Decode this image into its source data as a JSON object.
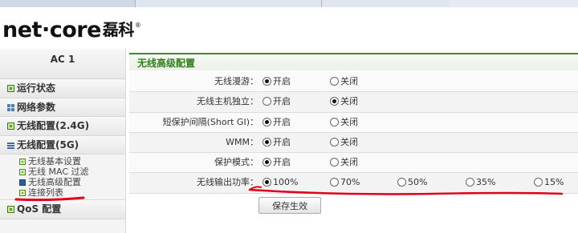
{
  "brand": {
    "logo_text": "net·core",
    "logo_cn": "磊科",
    "logo_mark": "®"
  },
  "sidebar": {
    "title": "AC 1",
    "items": [
      {
        "label": "运行状态",
        "icon": "green-square-icon"
      },
      {
        "label": "网络参数",
        "icon": "grid-icon"
      },
      {
        "label": "无线配置(2.4G)",
        "icon": "green-square-icon"
      },
      {
        "label": "无线配置(5G)",
        "icon": "lines-icon"
      }
    ],
    "subitems": [
      {
        "label": "无线基本设置",
        "active": false
      },
      {
        "label": "无线 MAC 过滤",
        "active": false
      },
      {
        "label": "无线高级配置",
        "active": true
      },
      {
        "label": "连接列表",
        "active": false
      }
    ],
    "last_item": {
      "label": "QoS 配置",
      "icon": "green-square-icon"
    }
  },
  "panel": {
    "title": "无线高级配置",
    "rows": [
      {
        "label": "无线漫游：",
        "options": [
          "开启",
          "关闭"
        ],
        "selected": 0
      },
      {
        "label": "无线主机独立：",
        "options": [
          "开启",
          "关闭"
        ],
        "selected": 1
      },
      {
        "label": "短保护间隔(Short GI)：",
        "options": [
          "开启",
          "关闭"
        ],
        "selected": 0
      },
      {
        "label": "WMM：",
        "options": [
          "开启",
          "关闭"
        ],
        "selected": 0
      },
      {
        "label": "保护模式：",
        "options": [
          "开启",
          "关闭"
        ],
        "selected": 0
      },
      {
        "label": "无线输出功率：",
        "options": [
          "100%",
          "70%",
          "50%",
          "35%",
          "15%"
        ],
        "selected": 0
      }
    ],
    "save_label": "保存生效"
  },
  "colors": {
    "accent_green": "#3c8f23",
    "annotation_red": "#e0001a"
  }
}
